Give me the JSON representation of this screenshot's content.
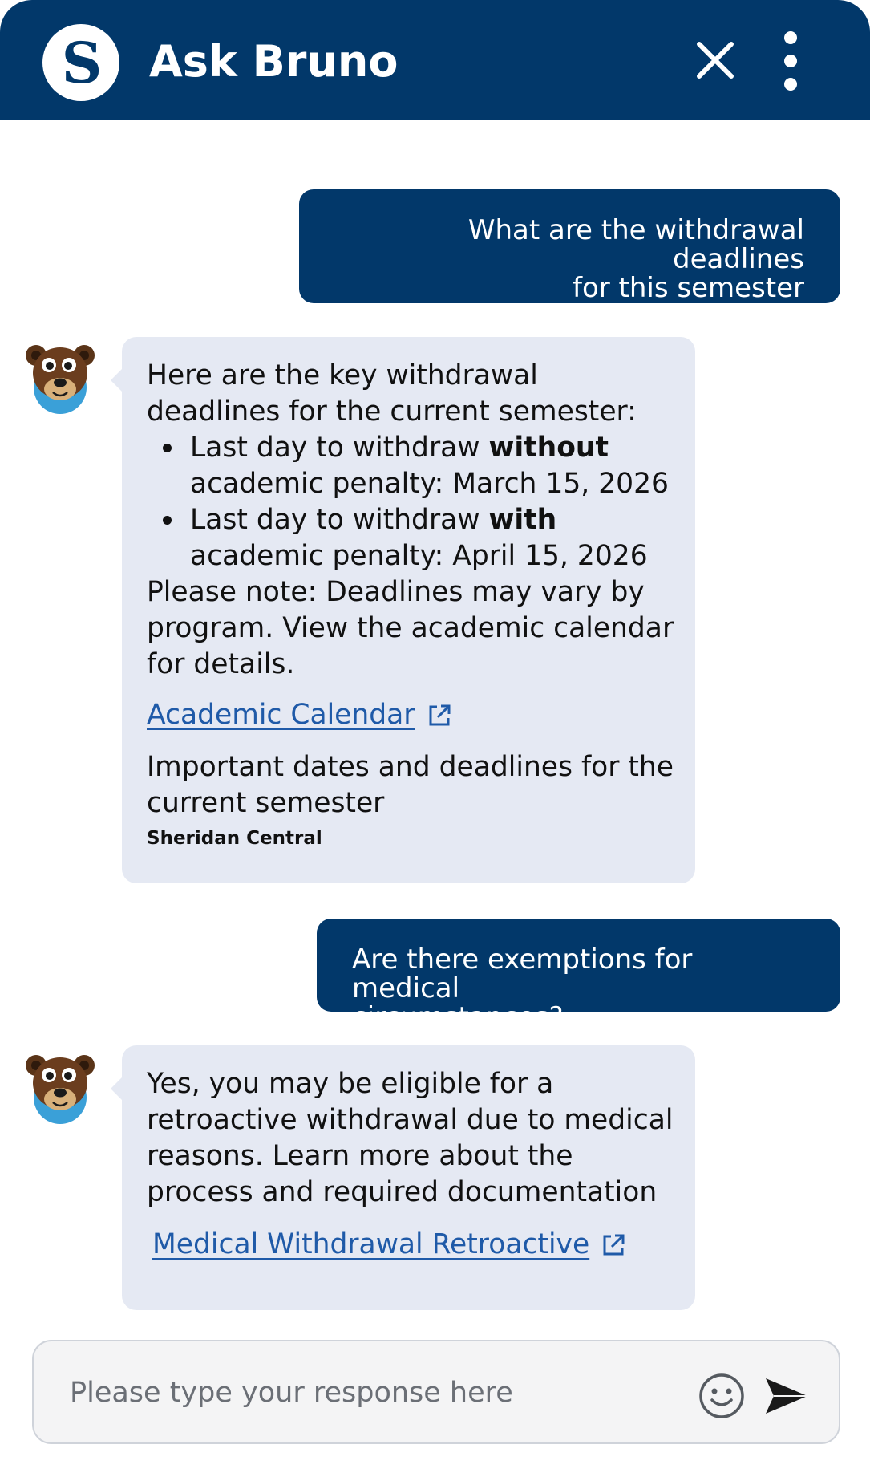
{
  "header": {
    "title": "Ask Bruno",
    "logo_letter": "S",
    "logo_icon": "sheridan-logo",
    "close_icon": "close-icon",
    "menu_icon": "more-vertical-icon",
    "background_color": "#02386a"
  },
  "messages": [
    {
      "role": "user",
      "text_line1": "What are the withdrawal deadlines",
      "text_line2": "for this semester"
    },
    {
      "role": "bot",
      "avatar_icon": "bruno-bear-avatar",
      "intro": "Here are the key withdrawal deadlines for the current semester:",
      "bullets": [
        {
          "prefix": "Last day to withdraw ",
          "bold": "without",
          "suffix": " academic penalty: March 15, 2026"
        },
        {
          "prefix": "Last day to withdraw ",
          "bold": "with",
          "suffix": " academic penalty: April 15, 2026"
        }
      ],
      "note": "Please note: Deadlines may vary by program. View the academic calendar for details.",
      "link_label": "Academic Calendar",
      "link_icon": "external-link-icon",
      "link_description": "Important dates and deadlines for the current semester",
      "link_source": "Sheridan Central"
    },
    {
      "role": "user",
      "text_line1": "Are there exemptions for medical",
      "text_line2": "circumstances?"
    },
    {
      "role": "bot",
      "avatar_icon": "bruno-bear-avatar",
      "text": "Yes, you may be eligible for a retroactive withdrawal due to medical reasons. Learn more about the process and required documentation",
      "link_label": "Medical Withdrawal Retroactive",
      "link_icon": "external-link-icon"
    }
  ],
  "composer": {
    "placeholder": "Please type your response here",
    "value": "",
    "emoji_icon": "smiley-icon",
    "send_icon": "send-icon"
  },
  "colors": {
    "primary": "#02386a",
    "bot_bubble": "#e5e9f3",
    "link": "#1f5aa8"
  }
}
